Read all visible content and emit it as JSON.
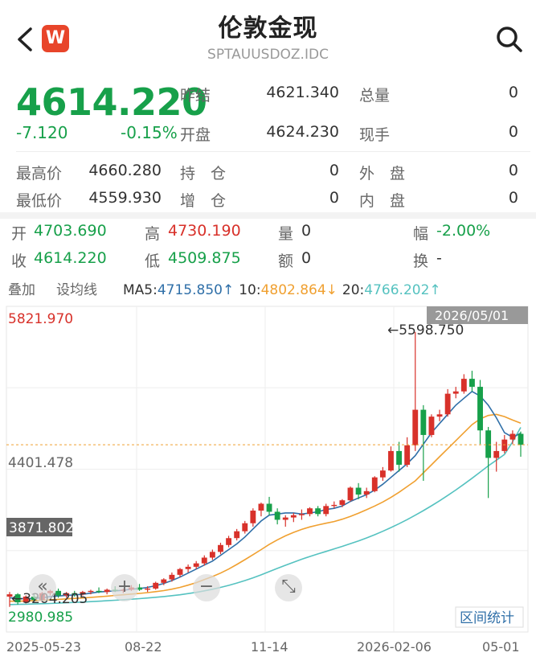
{
  "header": {
    "title": "伦敦金现",
    "subtitle": "SPTAUUSDOZ.IDC",
    "logo_letter": "W"
  },
  "quote": {
    "price": "4614.220",
    "change": "-7.120",
    "change_pct": "-0.15%",
    "row1": [
      {
        "label": "昨结",
        "value": "4621.340"
      },
      {
        "label": "总量",
        "value": "0"
      }
    ],
    "row2": [
      {
        "label": "开盘",
        "value": "4624.230"
      },
      {
        "label": "现手",
        "value": "0"
      }
    ],
    "details": [
      {
        "l1": "最高价",
        "v1": "4660.280",
        "l2": "持　仓",
        "v2": "0",
        "l3": "外　盘",
        "v3": "0"
      },
      {
        "l1": "最低价",
        "v1": "4559.930",
        "l2": "增　仓",
        "v2": "0",
        "l3": "内　盘",
        "v3": "0"
      }
    ]
  },
  "ohlc": {
    "open_label": "开",
    "open": "4703.690",
    "high_label": "高",
    "high": "4730.190",
    "vol_label": "量",
    "vol": "0",
    "amp_label": "幅",
    "amp": "-2.00%",
    "close_label": "收",
    "close": "4614.220",
    "low_label": "低",
    "low": "4509.875",
    "amt_label": "额",
    "amt": "0",
    "turn_label": "换",
    "turn": "-"
  },
  "ma_bar": {
    "overlay": "叠加",
    "set_line": "设均线",
    "ma5_label": "MA5:",
    "ma5": "4715.850↑",
    "ma10_label": "10:",
    "ma10": "4802.864↓",
    "ma20_label": "20:",
    "ma20": "4766.202↑"
  },
  "colors": {
    "up": "#d8312a",
    "down": "#17a04a",
    "ma5": "#2f6fa8",
    "ma10": "#f0a030",
    "ma20": "#55c2c0"
  },
  "chart_data": {
    "type": "candlestick",
    "ylim": [
      2980.985,
      5821.97
    ],
    "y_axis_labels": [
      "5821.970",
      "4401.478",
      "3871.802",
      "2980.985"
    ],
    "x_tick_labels": [
      "2025-05-23",
      "08-22",
      "11-14",
      "2026-02-06",
      "05-01"
    ],
    "date_badge": "2026/05/01",
    "annotations": {
      "max": "←5598.750",
      "min": "←3204.205"
    },
    "current_price_line": 4614.22,
    "range_stat_button": "区间统计",
    "candles": [
      [
        3290,
        3330,
        3200,
        3310
      ],
      [
        3310,
        3320,
        3220,
        3240
      ],
      [
        3240,
        3300,
        3230,
        3290
      ],
      [
        3290,
        3310,
        3250,
        3260
      ],
      [
        3260,
        3330,
        3240,
        3320
      ],
      [
        3320,
        3350,
        3300,
        3340
      ],
      [
        3340,
        3360,
        3280,
        3300
      ],
      [
        3300,
        3330,
        3280,
        3320
      ],
      [
        3320,
        3340,
        3290,
        3310
      ],
      [
        3310,
        3340,
        3300,
        3330
      ],
      [
        3330,
        3350,
        3310,
        3340
      ],
      [
        3340,
        3370,
        3320,
        3330
      ],
      [
        3330,
        3360,
        3310,
        3350
      ],
      [
        3350,
        3380,
        3330,
        3340
      ],
      [
        3340,
        3360,
        3320,
        3350
      ],
      [
        3350,
        3390,
        3340,
        3370
      ],
      [
        3370,
        3400,
        3340,
        3350
      ],
      [
        3350,
        3380,
        3330,
        3360
      ],
      [
        3360,
        3420,
        3350,
        3410
      ],
      [
        3410,
        3450,
        3390,
        3440
      ],
      [
        3440,
        3500,
        3420,
        3480
      ],
      [
        3480,
        3540,
        3460,
        3530
      ],
      [
        3530,
        3570,
        3500,
        3550
      ],
      [
        3550,
        3600,
        3530,
        3580
      ],
      [
        3580,
        3650,
        3560,
        3630
      ],
      [
        3630,
        3700,
        3610,
        3680
      ],
      [
        3680,
        3760,
        3660,
        3740
      ],
      [
        3740,
        3820,
        3720,
        3800
      ],
      [
        3800,
        3880,
        3780,
        3860
      ],
      [
        3860,
        3950,
        3840,
        3930
      ],
      [
        3930,
        4060,
        3900,
        4040
      ],
      [
        4040,
        4110,
        3990,
        4100
      ],
      [
        4100,
        4160,
        4000,
        4030
      ],
      [
        4030,
        4060,
        3920,
        3960
      ],
      [
        3960,
        4000,
        3900,
        3980
      ],
      [
        3980,
        4020,
        3940,
        4000
      ],
      [
        4000,
        4050,
        3960,
        4010
      ],
      [
        4010,
        4070,
        3990,
        4060
      ],
      [
        4060,
        4080,
        3990,
        4010
      ],
      [
        4010,
        4100,
        3990,
        4080
      ],
      [
        4080,
        4120,
        4060,
        4090
      ],
      [
        4090,
        4140,
        4070,
        4130
      ],
      [
        4130,
        4250,
        4120,
        4240
      ],
      [
        4240,
        4280,
        4140,
        4180
      ],
      [
        4180,
        4240,
        4150,
        4210
      ],
      [
        4210,
        4340,
        4200,
        4330
      ],
      [
        4330,
        4420,
        4300,
        4390
      ],
      [
        4390,
        4600,
        4380,
        4560
      ],
      [
        4560,
        4640,
        4380,
        4440
      ],
      [
        4440,
        4680,
        4420,
        4610
      ],
      [
        4610,
        5598.75,
        4560,
        4920
      ],
      [
        4920,
        4960,
        4300,
        4700
      ],
      [
        4700,
        4880,
        4680,
        4860
      ],
      [
        4860,
        4920,
        4820,
        4880
      ],
      [
        4880,
        5100,
        4860,
        5060
      ],
      [
        5060,
        5120,
        5020,
        5080
      ],
      [
        5080,
        5230,
        5060,
        5190
      ],
      [
        5190,
        5260,
        5080,
        5120
      ],
      [
        5120,
        5180,
        4620,
        4740
      ],
      [
        4740,
        4770,
        4150,
        4500
      ],
      [
        4500,
        4640,
        4380,
        4560
      ],
      [
        4560,
        4700,
        4540,
        4660
      ],
      [
        4660,
        4740,
        4620,
        4710
      ],
      [
        4710,
        4730,
        4510,
        4614.22
      ]
    ],
    "ma5": [
      3280,
      3275,
      3270,
      3275,
      3280,
      3290,
      3295,
      3300,
      3305,
      3310,
      3320,
      3330,
      3335,
      3340,
      3345,
      3355,
      3360,
      3370,
      3385,
      3405,
      3430,
      3460,
      3495,
      3530,
      3565,
      3600,
      3650,
      3700,
      3750,
      3810,
      3880,
      3950,
      4000,
      4010,
      4020,
      4020,
      4010,
      4020,
      4030,
      4050,
      4060,
      4080,
      4120,
      4150,
      4180,
      4220,
      4270,
      4330,
      4390,
      4450,
      4520,
      4620,
      4720,
      4800,
      4880,
      4960,
      5020,
      5080,
      5040,
      4960,
      4850,
      4720,
      4680,
      4715.85
    ],
    "ma10": [
      3250,
      3250,
      3252,
      3255,
      3258,
      3262,
      3266,
      3270,
      3274,
      3278,
      3283,
      3288,
      3294,
      3300,
      3306,
      3312,
      3318,
      3325,
      3333,
      3342,
      3355,
      3370,
      3390,
      3412,
      3438,
      3465,
      3495,
      3530,
      3570,
      3612,
      3656,
      3700,
      3745,
      3785,
      3820,
      3850,
      3876,
      3898,
      3915,
      3930,
      3945,
      3965,
      3990,
      4018,
      4048,
      4080,
      4115,
      4155,
      4200,
      4250,
      4300,
      4370,
      4440,
      4510,
      4580,
      4650,
      4720,
      4790,
      4840,
      4870,
      4880,
      4860,
      4830,
      4802.86
    ],
    "ma20": [
      3220,
      3222,
      3224,
      3226,
      3228,
      3230,
      3233,
      3236,
      3239,
      3242,
      3246,
      3250,
      3254,
      3258,
      3262,
      3267,
      3272,
      3278,
      3284,
      3290,
      3298,
      3306,
      3316,
      3327,
      3340,
      3354,
      3370,
      3388,
      3408,
      3430,
      3454,
      3480,
      3508,
      3536,
      3563,
      3590,
      3616,
      3640,
      3662,
      3684,
      3706,
      3728,
      3752,
      3776,
      3802,
      3830,
      3860,
      3892,
      3926,
      3962,
      4000,
      4040,
      4082,
      4126,
      4172,
      4220,
      4270,
      4322,
      4376,
      4430,
      4480,
      4530,
      4640,
      4766.2
    ]
  },
  "chart_tools": {
    "zoom_in": "+",
    "zoom_out": "−",
    "fullscreen": "⤡",
    "prev": "«"
  }
}
